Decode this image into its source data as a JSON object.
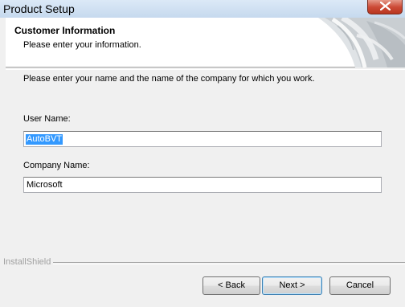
{
  "window": {
    "title": "Product Setup"
  },
  "header": {
    "title": "Customer Information",
    "subtitle": "Please enter your information."
  },
  "main": {
    "instruction": "Please enter your name and the name of the company for which you work.",
    "user_name_label": "User Name:",
    "user_name_value": "AutoBVT",
    "user_name_selected": true,
    "company_name_label": "Company Name:",
    "company_name_value": "Microsoft"
  },
  "footer": {
    "brand": "InstallShield",
    "back_label": "< Back",
    "next_label": "Next >",
    "cancel_label": "Cancel"
  },
  "colors": {
    "selection_highlight": "#3399ff",
    "close_button": "#c7472f",
    "dialog_background": "#f0f0f0"
  },
  "icons": [
    "close-icon",
    "installshield-header-art"
  ]
}
